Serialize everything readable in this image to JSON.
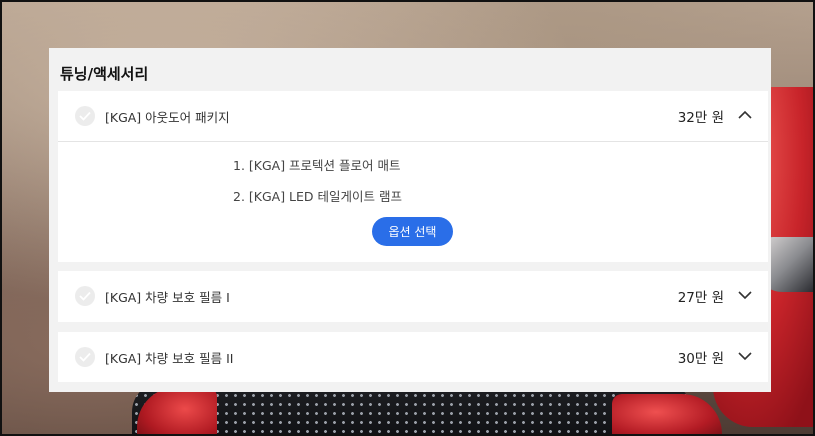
{
  "panel": {
    "title": "튜닝/액세서리"
  },
  "items": [
    {
      "label": "[KGA] 아웃도어 패키지",
      "price": "32만 원",
      "expanded": true,
      "chevron": "chevron-up-icon",
      "sub_items": [
        "1. [KGA] 프로텍션 플로어 매트",
        "2. [KGA] LED 테일게이트 램프"
      ],
      "button_label": "옵션 선택"
    },
    {
      "label": "[KGA] 차량 보호 필름 I",
      "price": "27만 원",
      "expanded": false,
      "chevron": "chevron-down-icon"
    },
    {
      "label": "[KGA] 차량 보호 필름 II",
      "price": "30만 원",
      "expanded": false,
      "chevron": "chevron-down-icon"
    }
  ],
  "colors": {
    "accent": "#2a6ee8",
    "panel_bg": "#f2f2f2",
    "card_bg": "#ffffff"
  }
}
